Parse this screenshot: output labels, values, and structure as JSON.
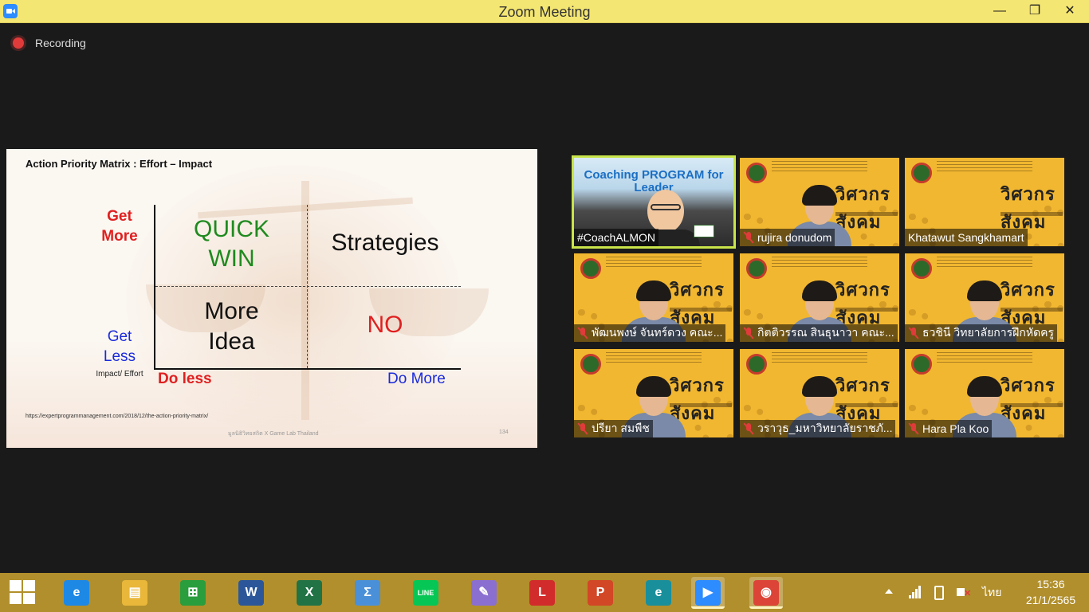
{
  "window": {
    "title": "Zoom Meeting"
  },
  "recording": {
    "label": "Recording"
  },
  "slide": {
    "title": "Action Priority Matrix : Effort – Impact",
    "y_axis_high": "Get More",
    "y_axis_low": "Get Less",
    "y_axis_caption": "Impact/ Effort",
    "x_axis_low": "Do less",
    "x_axis_high": "Do More",
    "quadrants": {
      "top_left": "QUICK WIN",
      "top_right": "Strategies",
      "bottom_left": "More Idea",
      "bottom_right": "NO"
    },
    "source_url": "https://expertprogrammanagement.com/2018/12/the-action-priority-matrix/",
    "footer": "มูลนิธิวิทยสถิต X Game Lab Thailand",
    "page_number": "134",
    "colors": {
      "red": "#e02020",
      "blue": "#1a2adb",
      "green": "#1f8a1f"
    }
  },
  "participants": [
    {
      "name": "#CoachALMON",
      "muted": false,
      "active_speaker": true,
      "video_title": "Coaching PROGRAM for Leader"
    },
    {
      "name": "rujira donudom",
      "muted": true,
      "active_speaker": false
    },
    {
      "name": "Khatawut Sangkhamart",
      "muted": false,
      "active_speaker": false
    },
    {
      "name": "พัฒนพงษ์ จันทร์ดวง คณะ...",
      "muted": true,
      "active_speaker": false
    },
    {
      "name": "กิตติวรรณ สินธุนาวา คณะ...",
      "muted": true,
      "active_speaker": false
    },
    {
      "name": "ธวชินี  วิทยาลัยการฝึกหัดครู",
      "muted": true,
      "active_speaker": false
    },
    {
      "name": "ปรียา สมพืช",
      "muted": true,
      "active_speaker": false
    },
    {
      "name": "วราวุธ_มหาวิทยาลัยราชภั...",
      "muted": true,
      "active_speaker": false
    },
    {
      "name": "Hara Pla Koo",
      "muted": true,
      "active_speaker": false
    }
  ],
  "tile_banner": {
    "big": "วิศวกร สังคม"
  },
  "taskbar": {
    "apps": [
      {
        "name": "internet-explorer-icon",
        "glyph": "e",
        "color": "#1e88e5"
      },
      {
        "name": "file-explorer-icon",
        "glyph": "▤",
        "color": "#e9b73a"
      },
      {
        "name": "store-icon",
        "glyph": "⊞",
        "color": "#2a9d3c"
      },
      {
        "name": "word-icon",
        "glyph": "W",
        "color": "#2b579a"
      },
      {
        "name": "excel-icon",
        "glyph": "X",
        "color": "#217346"
      },
      {
        "name": "math-input-icon",
        "glyph": "Σ",
        "color": "#4a90d9"
      },
      {
        "name": "line-icon",
        "glyph": "LINE",
        "color": "#06c755"
      },
      {
        "name": "paint-icon",
        "glyph": "✎",
        "color": "#8a6fd1"
      },
      {
        "name": "lisrel-icon",
        "glyph": "L",
        "color": "#d22b2b"
      },
      {
        "name": "powerpoint-icon",
        "glyph": "P",
        "color": "#d24726"
      },
      {
        "name": "edge-icon",
        "glyph": "e",
        "color": "#1a8f9c"
      },
      {
        "name": "zoom-icon",
        "glyph": "▶",
        "color": "#2d8cff"
      },
      {
        "name": "chrome-icon",
        "glyph": "◉",
        "color": "#db4437"
      }
    ],
    "tray": {
      "language": "ไทย",
      "time": "15:36",
      "date": "21/1/2565"
    }
  }
}
